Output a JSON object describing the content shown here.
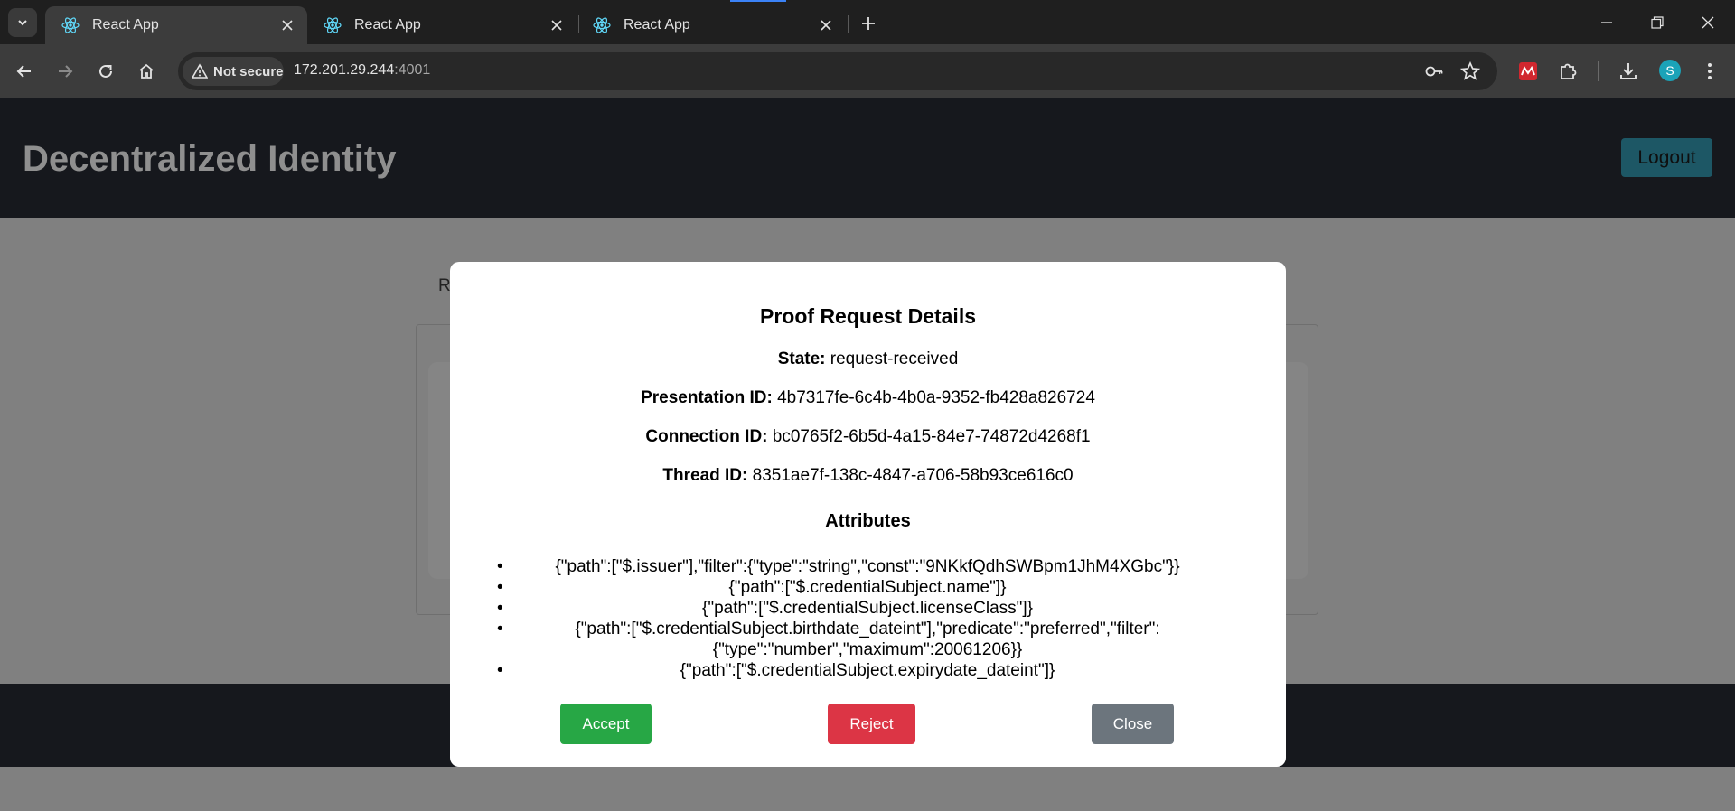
{
  "browser": {
    "tabs": [
      {
        "title": "React App",
        "active": true
      },
      {
        "title": "React App",
        "active": false
      },
      {
        "title": "React App",
        "active": false
      }
    ],
    "security_label": "Not secure",
    "url_host": "172.201.29.244",
    "url_port": ":4001",
    "avatar_initial": "S",
    "colors": {
      "tabbar": "#1f1f1f",
      "toolbar": "#3c3c3c",
      "avatar": "#1ba3b8"
    }
  },
  "app": {
    "title": "Decentralized Identity",
    "logout_label": "Logout",
    "background_tab_char": "R"
  },
  "modal": {
    "title": "Proof Request Details",
    "fields": [
      {
        "label": "State:",
        "value": "request-received"
      },
      {
        "label": "Presentation ID:",
        "value": "4b7317fe-6c4b-4b0a-9352-fb428a826724"
      },
      {
        "label": "Connection ID:",
        "value": "bc0765f2-6b5d-4a15-84e7-74872d4268f1"
      },
      {
        "label": "Thread ID:",
        "value": "8351ae7f-138c-4847-a706-58b93ce616c0"
      }
    ],
    "attributes_title": "Attributes",
    "attributes": [
      "{\"path\":[\"$.issuer\"],\"filter\":{\"type\":\"string\",\"const\":\"9NKkfQdhSWBpm1JhM4XGbc\"}}",
      "{\"path\":[\"$.credentialSubject.name\"]}",
      "{\"path\":[\"$.credentialSubject.licenseClass\"]}",
      "{\"path\":[\"$.credentialSubject.birthdate_dateint\"],\"predicate\":\"preferred\",\"filter\":{\"type\":\"number\",\"maximum\":20061206}}",
      "{\"path\":[\"$.credentialSubject.expirydate_dateint\"]}"
    ],
    "buttons": {
      "accept": "Accept",
      "reject": "Reject",
      "close": "Close"
    },
    "colors": {
      "accept": "#27a745",
      "reject": "#dc3545",
      "close": "#6c757d"
    }
  }
}
